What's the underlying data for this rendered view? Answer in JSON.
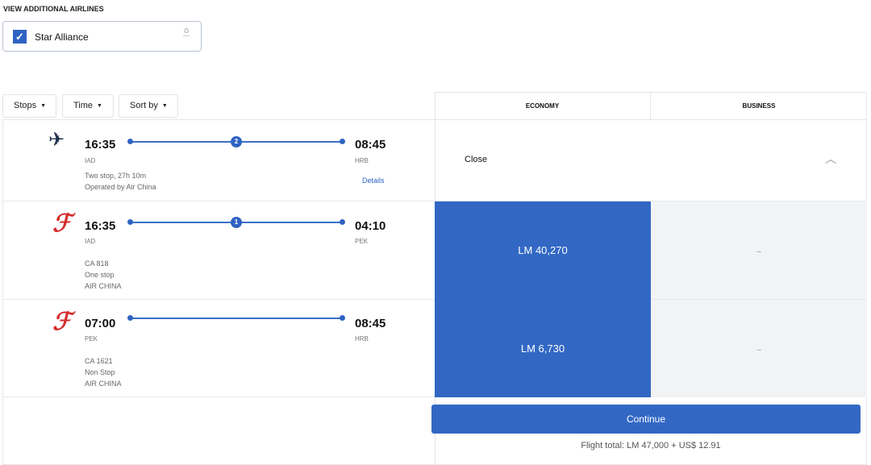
{
  "additional": {
    "title": "VIEW ADDITIONAL AIRLINES",
    "alliance": "Star Alliance",
    "checked": true
  },
  "filters": {
    "stops": "Stops",
    "time": "Time",
    "sort": "Sort by"
  },
  "cabins": {
    "economy": "ECONOMY",
    "business": "BUSINESS"
  },
  "summary": {
    "dep_time": "16:35",
    "dep": "IAD",
    "arr_time": "08:45",
    "arr": "HRB",
    "stops_count": "2",
    "duration": "Two stop, 27h 10m",
    "operated": "Operated by Air China",
    "details": "Details",
    "close": "Close"
  },
  "segments": [
    {
      "dep_time": "16:35",
      "dep": "IAD",
      "arr_time": "04:10",
      "arr": "PEK",
      "stops_count": "1",
      "flight": "CA 818",
      "stops": "One stop",
      "airline": "AIR CHINA",
      "economy": "LM 40,270",
      "business": "–"
    },
    {
      "dep_time": "07:00",
      "dep": "PEK",
      "arr_time": "08:45",
      "arr": "HRB",
      "flight": "CA 1621",
      "stops": "Non Stop",
      "airline": "AIR CHINA",
      "economy": "LM 6,730",
      "business": "–"
    }
  ],
  "continue": "Continue",
  "total": "Flight total: LM 47,000 + US$ 12.91",
  "colors": {
    "primary": "#3268c4",
    "airline_red": "#d62c2c"
  }
}
